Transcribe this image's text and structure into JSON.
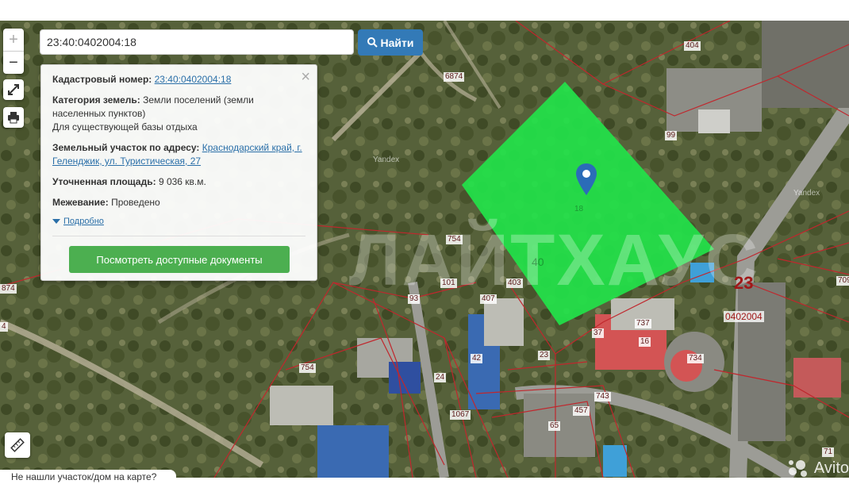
{
  "search": {
    "value": "23:40:0402004:18",
    "button_label": "Найти"
  },
  "controls": {
    "zoom_in": "+",
    "zoom_out": "−"
  },
  "popup": {
    "cadastral_label": "Кадастровый номер:",
    "cadastral_value": "23:40:0402004:18",
    "category_label": "Категория земель:",
    "category_value": "Земли поселений (земли населенных пунктов)",
    "category_note": "Для существующей базы отдыха",
    "address_label": "Земельный участок по адресу:",
    "address_value": "Краснодарский край, г. Геленджик, ул. Туристическая, 27",
    "area_label": "Уточненная площадь:",
    "area_value": "9 036 кв.м.",
    "survey_label": "Межевание:",
    "survey_value": "Проведено",
    "more_link": "Подробно",
    "docs_button": "Посмотреть доступные документы"
  },
  "map": {
    "watermark": "ЛАЙТХАУС",
    "provider_labels": [
      "Yandex",
      "Yandex"
    ],
    "district_number": "23",
    "quarter_code": "0402004",
    "parcel_labels": [
      "404",
      "6874",
      "99",
      "18",
      "754",
      "40",
      "101",
      "403",
      "93",
      "407",
      "737",
      "37",
      "16",
      "734",
      "23",
      "42",
      "24",
      "754",
      "1067",
      "743",
      "65",
      "457",
      "874",
      "709",
      "4",
      "71"
    ],
    "parcel_color": "#22e34a"
  },
  "bottom_hint": "Не нашли участок/дом на карте?",
  "brand": "Avito"
}
